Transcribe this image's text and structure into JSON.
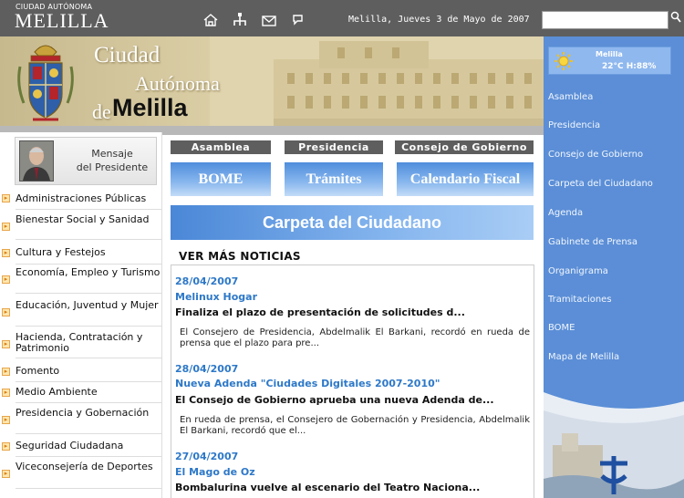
{
  "header": {
    "logo_small": "CIUDAD AUTÓNOMA",
    "logo_big": "MELILLA",
    "date": "Melilla, Jueves 3 de Mayo de 2007",
    "search_placeholder": "",
    "icons": [
      "home-icon",
      "sitemap-icon",
      "mail-icon",
      "language-icon",
      "search-icon"
    ]
  },
  "banner": {
    "line1": "Ciudad",
    "line2": "Autónoma",
    "line3_de": "de",
    "line3_name": "Melilla"
  },
  "weather": {
    "city": "Melilla",
    "reading": "22°C  H:88%"
  },
  "right_menu": [
    "Asamblea",
    "Presidencia",
    "Consejo de Gobierno",
    "Carpeta del Ciudadano",
    "Agenda",
    "Gabinete de Prensa",
    "Organigrama",
    "Tramitaciones",
    "BOME",
    "Mapa de Melilla"
  ],
  "president": {
    "line1": "Mensaje",
    "line2": "del Presidente"
  },
  "left_menu": [
    "Administraciones Públicas",
    "Bienestar Social y Sanidad",
    "Cultura y Festejos",
    "Economía, Empleo y Turismo",
    "Educación, Juventud y Mujer",
    "Hacienda, Contratación y Patrimonio",
    "Fomento",
    "Medio Ambiente",
    "Presidencia y Gobernación",
    "Seguridad Ciudadana",
    "Viceconsejería de Deportes"
  ],
  "top_buttons": [
    "Asamblea",
    "Presidencia",
    "Consejo de Gobierno"
  ],
  "blue_buttons": [
    "BOME",
    "Trámites",
    "Calendario Fiscal"
  ],
  "carpeta": "Carpeta del Ciudadano",
  "ver_mas": "VER MÁS NOTICIAS",
  "news": [
    {
      "date": "28/04/2007",
      "category": "Melinux Hogar",
      "title": "Finaliza el plazo de presentación de solicitudes d...",
      "body": "El Consejero de Presidencia, Abdelmalik El Barkani, recordó en rueda de prensa que el plazo para pre..."
    },
    {
      "date": "28/04/2007",
      "category": "Nueva Adenda \"Ciudades Digitales 2007-2010\"",
      "title": "El Consejo de Gobierno aprueba una nueva Adenda de...",
      "body": "En rueda de prensa, el Consejero de Gobernación y Presidencia, Abdelmalik El Barkani, recordó que el..."
    },
    {
      "date": "27/04/2007",
      "category": "El Mago de Oz",
      "title": "Bombalurina vuelve al escenario del Teatro Naciona...",
      "body": ""
    }
  ]
}
